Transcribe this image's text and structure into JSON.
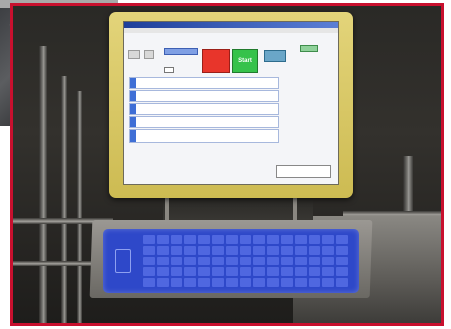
{
  "back_photo": {},
  "screen": {
    "title": "",
    "menu": "",
    "buttons": {
      "small1": "",
      "small2": "",
      "blue1": "",
      "red": "",
      "green": "Start",
      "teal": "",
      "green2": ""
    },
    "field_label": "",
    "field_value": "",
    "steps": [
      "",
      "",
      "",
      "",
      ""
    ],
    "status": ""
  },
  "colors": {
    "frame_border": "#c8102e",
    "monitor_bezel": "#d8c860",
    "keyboard": "#2e48c9",
    "start_button": "#36c24b",
    "alert_button": "#e8352b"
  }
}
